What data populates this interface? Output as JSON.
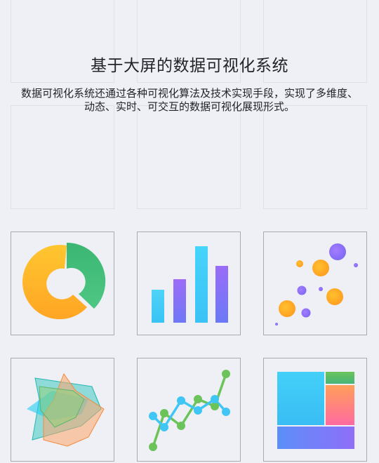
{
  "hero": {
    "title": "基于大屏的数据可视化系统",
    "description": "数据可视化系统还通过各种可视化算法及技术实现手段，实现了多维度、动态、实时、可交互的数据可视化展现形式。"
  },
  "tiles": [
    {
      "icon": "donut-chart-icon"
    },
    {
      "icon": "bar-chart-icon"
    },
    {
      "icon": "bubble-chart-icon"
    },
    {
      "icon": "radar-chart-icon"
    },
    {
      "icon": "line-chart-icon"
    },
    {
      "icon": "treemap-chart-icon"
    }
  ],
  "colors": {
    "background": "#eef0f5",
    "yellow": "#ffc12e",
    "orange": "#ffa524",
    "green": "#3cb774",
    "cyan": "#3ccdf7",
    "purple": "#9a6cf7",
    "pink": "#ff6aa0"
  }
}
